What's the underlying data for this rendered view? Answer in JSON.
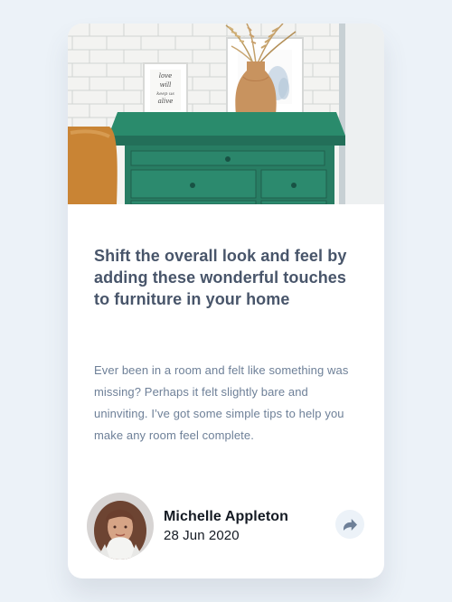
{
  "article": {
    "headline": "Shift the overall look and feel by adding these wonderful touches to furniture in your home",
    "excerpt": "Ever been in a room and felt like something was missing? Perhaps it felt slightly bare and uninviting. I’ve got some simple tips to help you make any room feel complete."
  },
  "author": {
    "name": "Michelle Appleton",
    "date": "28 Jun 2020"
  },
  "image_text": {
    "frame_note": "love will keep us alive"
  },
  "icons": {
    "share": "share-icon"
  },
  "colors": {
    "page_background": "#ecf2f8",
    "headline": "#48556a",
    "body_text": "#6e8098",
    "author_text": "#141a23",
    "share_button": "#ecf2f8",
    "share_icon": "#6e8098"
  }
}
